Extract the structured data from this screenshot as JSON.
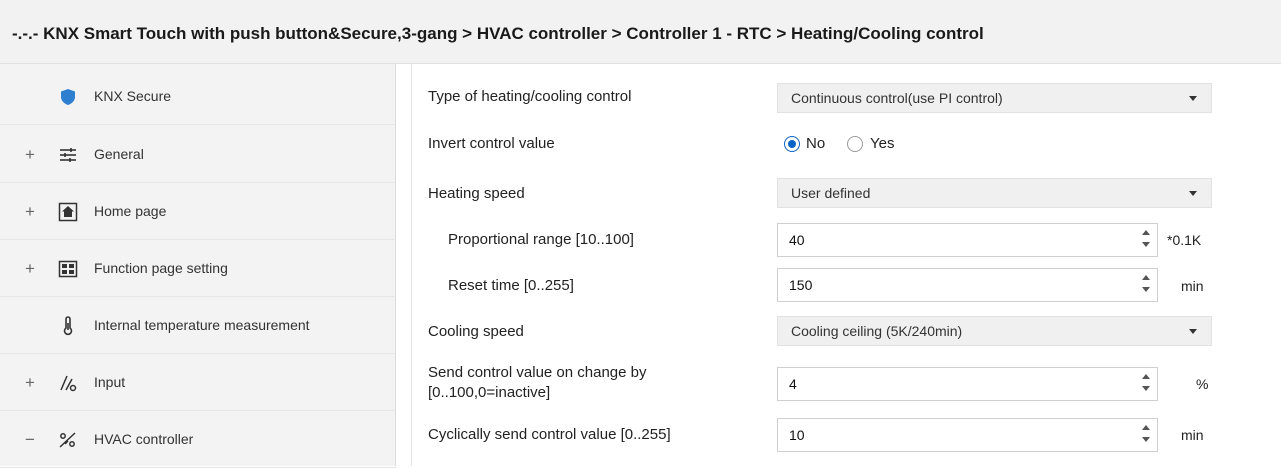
{
  "breadcrumb": "-.-.- KNX Smart Touch with push button&Secure,3-gang > HVAC controller > Controller 1 - RTC > Heating/Cooling control",
  "sidebar": {
    "items": [
      {
        "label": "KNX Secure",
        "expander": "",
        "icon": "shield-icon"
      },
      {
        "label": "General",
        "expander": "+",
        "icon": "sliders-icon"
      },
      {
        "label": "Home page",
        "expander": "+",
        "icon": "home-icon"
      },
      {
        "label": "Function page setting",
        "expander": "+",
        "icon": "grid-icon"
      },
      {
        "label": "Internal temperature measurement",
        "expander": "",
        "icon": "thermometer-icon"
      },
      {
        "label": "Input",
        "expander": "+",
        "icon": "input-icon"
      },
      {
        "label": "HVAC controller",
        "expander": "−",
        "icon": "hvac-icon"
      }
    ]
  },
  "params": {
    "type_label": "Type of heating/cooling control",
    "type_value": "Continuous control(use PI control)",
    "invert_label": "Invert control value",
    "invert_no": "No",
    "invert_yes": "Yes",
    "invert_selected": "No",
    "heating_speed_label": "Heating speed",
    "heating_speed_value": "User defined",
    "prop_range_label": "Proportional range [10..100]",
    "prop_range_value": "40",
    "prop_range_unit": "*0.1K",
    "reset_time_label": "Reset time [0..255]",
    "reset_time_value": "150",
    "reset_time_unit": "min",
    "cooling_speed_label": "Cooling speed",
    "cooling_speed_value": "Cooling ceiling (5K/240min)",
    "send_change_label_1": "Send control value on change by",
    "send_change_label_2": "[0..100,0=inactive]",
    "send_change_value": "4",
    "send_change_unit": "%",
    "cyclic_label": "Cyclically send control value [0..255]",
    "cyclic_value": "10",
    "cyclic_unit": "min"
  },
  "colors": {
    "accent": "#0a64c8",
    "sidebar_bg": "#f3f3f3",
    "select_bg": "#f0f0f0"
  }
}
